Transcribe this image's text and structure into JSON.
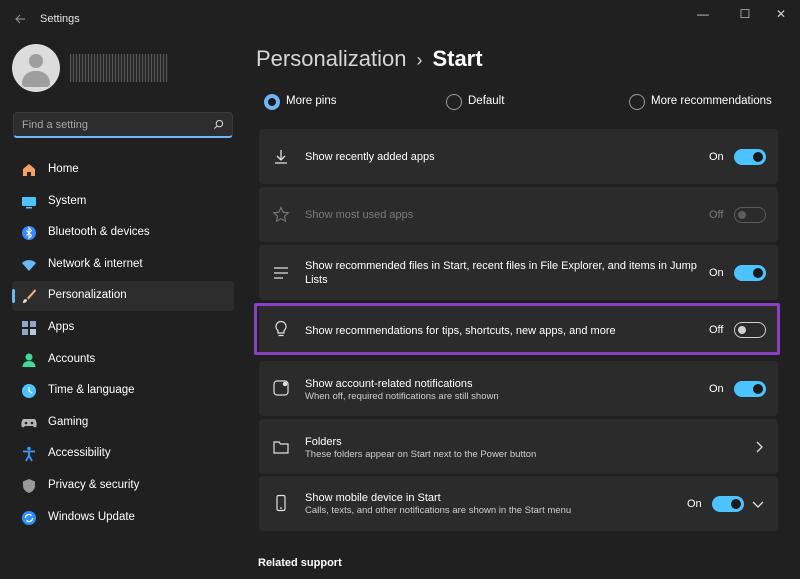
{
  "window": {
    "title": "Settings",
    "controls": {
      "minimize": "—",
      "maximize": "☐",
      "close": "✕"
    }
  },
  "search": {
    "placeholder": "Find a setting",
    "value": ""
  },
  "sidebar": {
    "items": [
      {
        "label": "Home",
        "icon": "home-icon",
        "color": "#f4a261"
      },
      {
        "label": "System",
        "icon": "system-icon",
        "color": "#4cc2ff"
      },
      {
        "label": "Bluetooth & devices",
        "icon": "bluetooth-icon",
        "color": "#3a86ff"
      },
      {
        "label": "Network & internet",
        "icon": "wifi-icon",
        "color": "#6cb8f6"
      },
      {
        "label": "Personalization",
        "icon": "brush-icon",
        "color": "#f4b183",
        "active": true
      },
      {
        "label": "Apps",
        "icon": "apps-icon",
        "color": "#8fa8c8"
      },
      {
        "label": "Accounts",
        "icon": "accounts-icon",
        "color": "#3ddc97"
      },
      {
        "label": "Time & language",
        "icon": "time-language-icon",
        "color": "#4cc2ff"
      },
      {
        "label": "Gaming",
        "icon": "gaming-icon",
        "color": "#b5b5b5"
      },
      {
        "label": "Accessibility",
        "icon": "accessibility-icon",
        "color": "#3a9bff"
      },
      {
        "label": "Privacy & security",
        "icon": "shield-icon",
        "color": "#9a9a9a"
      },
      {
        "label": "Windows Update",
        "icon": "windows-update-icon",
        "color": "#2f8fff"
      }
    ]
  },
  "breadcrumb": {
    "parent": "Personalization",
    "separator": "›",
    "current": "Start"
  },
  "layout_options": {
    "selected": "More pins",
    "options": [
      "More pins",
      "Default",
      "More recommendations"
    ]
  },
  "settings": [
    {
      "title": "Show recently added apps",
      "subtitle": "",
      "state": "On",
      "icon": "download-icon"
    },
    {
      "title": "Show most used apps",
      "subtitle": "",
      "state": "Off",
      "icon": "star-icon",
      "disabled": true
    },
    {
      "title": "Show recommended files in Start, recent files in File Explorer, and items in Jump Lists",
      "subtitle": "",
      "state": "On",
      "icon": "list-icon"
    },
    {
      "title": "Show recommendations for tips, shortcuts, new apps, and more",
      "subtitle": "",
      "state": "Off",
      "icon": "lightbulb-icon",
      "highlighted": true
    },
    {
      "title": "Show account-related notifications",
      "subtitle": "When off, required notifications are still shown",
      "state": "On",
      "icon": "notification-icon"
    },
    {
      "title": "Folders",
      "subtitle": "These folders appear on Start next to the Power button",
      "state": "",
      "icon": "folder-icon"
    },
    {
      "title": "Show mobile device in Start",
      "subtitle": "Calls, texts, and other notifications are shown in the Start menu",
      "state": "On",
      "icon": "phone-icon"
    }
  ],
  "related": {
    "heading": "Related support"
  },
  "colors": {
    "accent": "#4cc2ff",
    "highlight_border": "#8a3fc7",
    "card": "#2b2b2b",
    "background": "#202020"
  }
}
